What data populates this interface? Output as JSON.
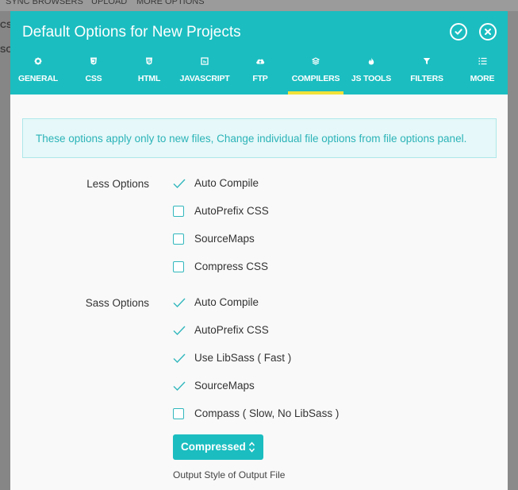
{
  "background": {
    "top_strip_texts": [
      "SYNC BROWSERS",
      "UPLOAD",
      "MORE OPTIONS"
    ],
    "left_fragments": [
      "CS",
      "SC"
    ]
  },
  "dialog": {
    "title": "Default Options for New Projects",
    "accent_color": "#1bbdc0",
    "active_tab_underline_color": "#f2e13a",
    "tabs": [
      {
        "label": "GENERAL",
        "icon": "gear-icon"
      },
      {
        "label": "CSS",
        "icon": "css-shield-icon"
      },
      {
        "label": "HTML",
        "icon": "html-shield-icon"
      },
      {
        "label": "JAVASCRIPT",
        "icon": "javascript-icon"
      },
      {
        "label": "FTP",
        "icon": "cloud-upload-icon"
      },
      {
        "label": "COMPILERS",
        "icon": "layers-icon",
        "active": true
      },
      {
        "label": "JS TOOLS",
        "icon": "flame-icon"
      },
      {
        "label": "FILTERS",
        "icon": "filter-icon"
      },
      {
        "label": "MORE",
        "icon": "list-icon"
      }
    ],
    "notice": "These options apply only to new files, Change individual file options from file options panel.",
    "less": {
      "label": "Less Options",
      "options": [
        {
          "label": "Auto Compile",
          "checked": true
        },
        {
          "label": "AutoPrefix CSS",
          "checked": false
        },
        {
          "label": "SourceMaps",
          "checked": false
        },
        {
          "label": "Compress CSS",
          "checked": false
        }
      ]
    },
    "sass": {
      "label": "Sass Options",
      "options": [
        {
          "label": "Auto Compile",
          "checked": true
        },
        {
          "label": "AutoPrefix CSS",
          "checked": true
        },
        {
          "label": "Use LibSass ( Fast )",
          "checked": true
        },
        {
          "label": "SourceMaps",
          "checked": true
        },
        {
          "label": "Compass ( Slow, No LibSass )",
          "checked": false
        }
      ]
    },
    "output_style": {
      "selected": "Compressed",
      "help": "Output Style of Output File"
    }
  }
}
